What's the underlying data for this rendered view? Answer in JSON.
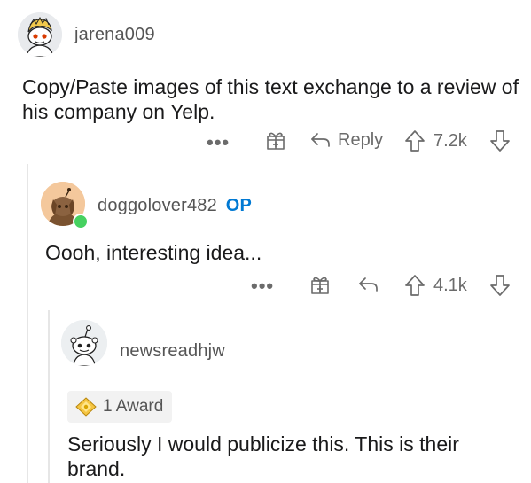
{
  "comments": [
    {
      "username": "jarena009",
      "text": "Copy/Paste images of this text exchange to a review of his company on Yelp.",
      "actions": {
        "more": "•••",
        "reply_label": "Reply",
        "score": "7.2k"
      }
    },
    {
      "username": "doggolover482",
      "op_badge": "OP",
      "text": "Oooh, interesting idea...",
      "actions": {
        "more": "•••",
        "score": "4.1k"
      }
    },
    {
      "username": "newsreadhjw",
      "award_label": "1 Award",
      "text": "Seriously I would publicize this. This is their brand."
    }
  ],
  "colors": {
    "op": "#0079d3",
    "online": "#46d160",
    "muted": "#6b6b6b",
    "thread_line": "#e6e6e6"
  }
}
